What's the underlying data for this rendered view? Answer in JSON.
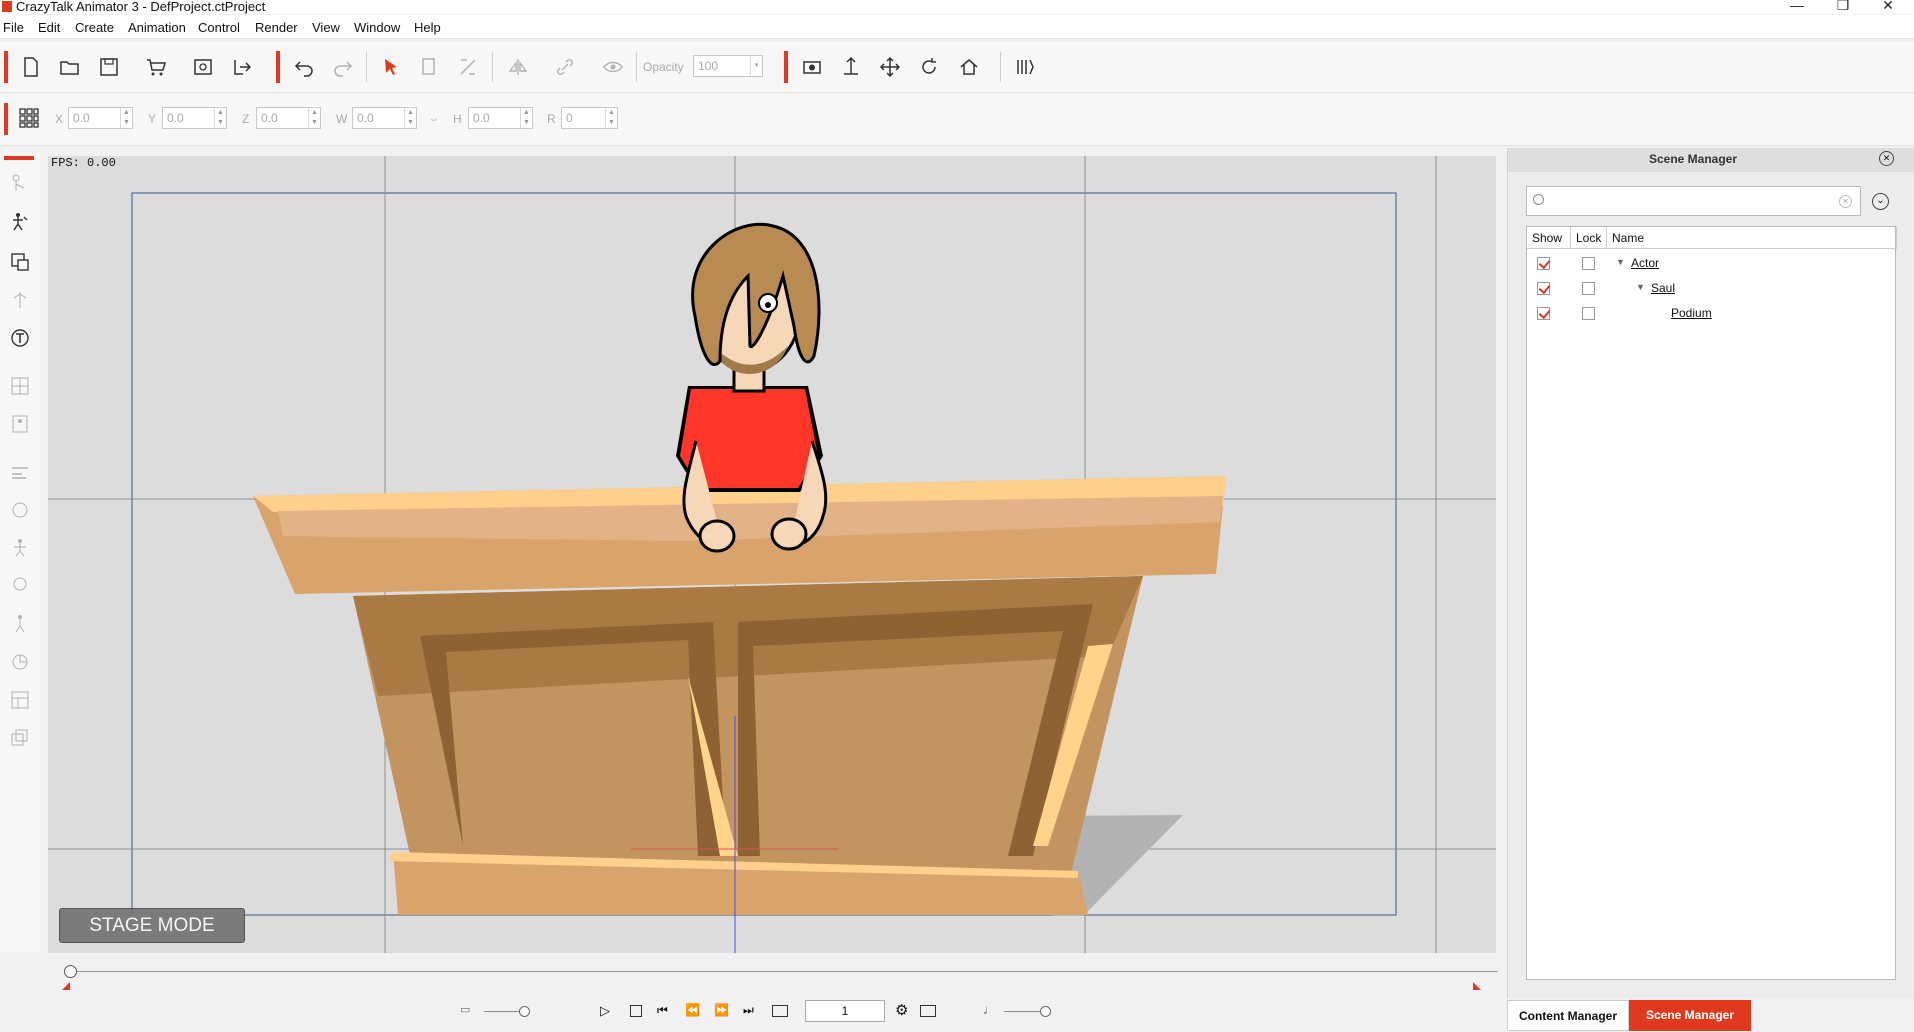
{
  "app": {
    "title": "CrazyTalk Animator 3  - DefProject.ctProject"
  },
  "menu": [
    "File",
    "Edit",
    "Create",
    "Animation",
    "Control",
    "Render",
    "View",
    "Window",
    "Help"
  ],
  "toolbar": {
    "opacity_label": "Opacity",
    "opacity_value": "100",
    "icons": [
      "new-file-icon",
      "open-folder-icon",
      "save-icon",
      "content-store-icon",
      "preview-icon",
      "export-icon",
      "undo-icon",
      "redo-icon",
      "select-arrow-icon",
      "clone-icon",
      "transform-icon",
      "flip-icon",
      "link-icon",
      "visibility-icon",
      "camera-icon",
      "move-z-icon",
      "move-icon",
      "rotate-icon",
      "home-icon",
      "render-icon"
    ]
  },
  "transform": {
    "fields": [
      {
        "label": "X",
        "value": "0.0"
      },
      {
        "label": "Y",
        "value": "0.0"
      },
      {
        "label": "Z",
        "value": "0.0"
      },
      {
        "label": "W",
        "value": "0.0"
      },
      {
        "label": "H",
        "value": "0.0"
      },
      {
        "label": "R",
        "value": "0"
      }
    ]
  },
  "stage": {
    "fps": "FPS: 0.00",
    "mode_label": "STAGE MODE"
  },
  "playback": {
    "frame": "1"
  },
  "scene_manager": {
    "title": "Scene Manager",
    "search_placeholder": "",
    "columns": [
      "Show",
      "Lock",
      "Name"
    ],
    "rows": [
      {
        "name": "Actor",
        "show": true,
        "lock": false,
        "level": 0,
        "expanded": true
      },
      {
        "name": "Saul",
        "show": true,
        "lock": false,
        "level": 1,
        "expanded": true
      },
      {
        "name": "Podium",
        "show": true,
        "lock": false,
        "level": 2,
        "expanded": false
      }
    ]
  },
  "tabs": {
    "content": "Content Manager",
    "scene": "Scene Manager"
  },
  "colors": {
    "accent": "#e03a1e",
    "panel": "#ececec",
    "viewport": "#dcdcdc"
  }
}
